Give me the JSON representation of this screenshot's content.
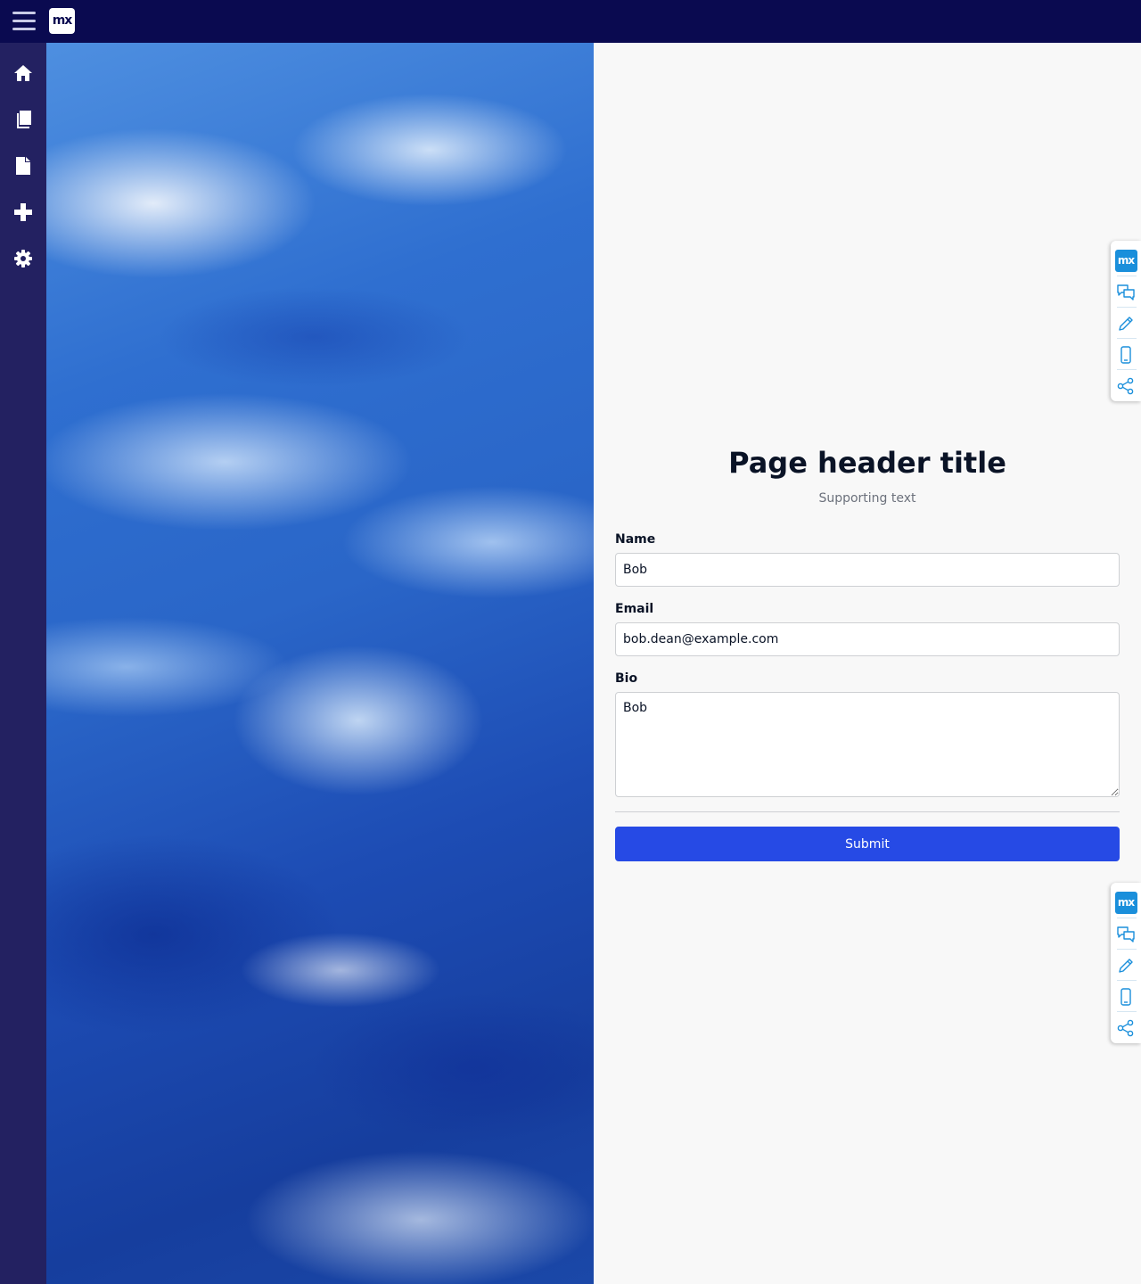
{
  "app": {
    "logo_text": "mx"
  },
  "sidebar": {
    "items": [
      {
        "icon": "home-icon"
      },
      {
        "icon": "book-icon"
      },
      {
        "icon": "file-icon"
      },
      {
        "icon": "plus-icon"
      },
      {
        "icon": "gear-icon"
      }
    ]
  },
  "page": {
    "title": "Page header title",
    "subtitle": "Supporting text"
  },
  "form": {
    "name_label": "Name",
    "name_value": "Bob",
    "email_label": "Email",
    "email_value": "bob.dean@example.com",
    "bio_label": "Bio",
    "bio_value": "Bob",
    "submit_label": "Submit"
  },
  "float_toolbar": {
    "logo_text": "mx",
    "items": [
      "chat-icon",
      "pencil-icon",
      "mobile-icon",
      "share-icon"
    ]
  },
  "colors": {
    "topbar": "#0a0a50",
    "sidebar": "#232161",
    "primary_button": "#264ae5",
    "toolbar_accent": "#1a8fdb"
  }
}
